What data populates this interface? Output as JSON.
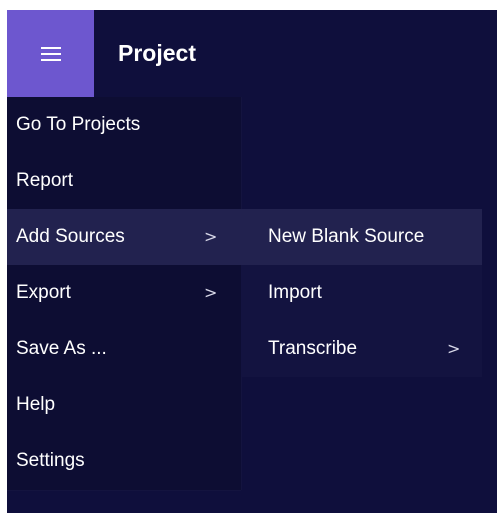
{
  "header": {
    "menu_icon": "hamburger-icon",
    "title": "Project"
  },
  "menu": {
    "items": [
      {
        "label": "Go To Projects",
        "chevron": ""
      },
      {
        "label": "Report",
        "chevron": ""
      },
      {
        "label": "Add Sources",
        "chevron": ">"
      },
      {
        "label": "Export",
        "chevron": ">"
      },
      {
        "label": "Save As ...",
        "chevron": ""
      },
      {
        "label": "Help",
        "chevron": ""
      },
      {
        "label": "Settings",
        "chevron": ""
      }
    ]
  },
  "submenu": {
    "items": [
      {
        "label": "New Blank Source",
        "chevron": ""
      },
      {
        "label": "Import",
        "chevron": ""
      },
      {
        "label": "Transcribe",
        "chevron": ">"
      }
    ]
  },
  "colors": {
    "background": "#0f0f3c",
    "menu_button": "#6d57cf",
    "highlight": "#22224f",
    "text": "#ffffff"
  }
}
